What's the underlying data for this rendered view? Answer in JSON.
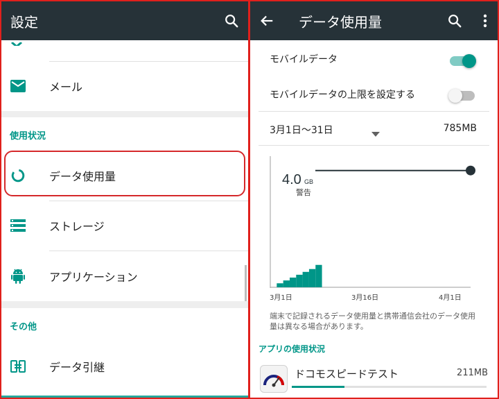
{
  "left": {
    "title": "設定",
    "items_top": [
      {
        "label": "メール",
        "icon": "email-icon"
      }
    ],
    "section_usage": "使用状況",
    "items_usage": [
      {
        "label": "データ使用量",
        "icon": "data-usage-icon"
      },
      {
        "label": "ストレージ",
        "icon": "storage-icon"
      },
      {
        "label": "アプリケーション",
        "icon": "android-icon"
      }
    ],
    "section_other": "その他",
    "items_other": [
      {
        "label": "データ引継",
        "icon": "transfer-icon"
      }
    ]
  },
  "right": {
    "title": "データ使用量",
    "mobile_data_label": "モバイルデータ",
    "mobile_data_on": true,
    "limit_label": "モバイルデータの上限を設定する",
    "limit_on": false,
    "cycle": "3月1日～31日",
    "cycle_total": "785MB",
    "warning_value": "4.0",
    "warning_unit": "GB",
    "warning_label": "警告",
    "note": "端末で記録されるデータ使用量と携帯通信会社のデータ使用量は異なる場合があります。",
    "apps_section": "アプリの使用状況",
    "app": {
      "name": "ドコモスピードテスト",
      "usage": "211MB",
      "usage_fraction": 0.27
    }
  },
  "colors": {
    "appbar": "#263238",
    "accent": "#009688",
    "highlight": "#d5282a"
  },
  "chart_data": {
    "type": "area",
    "x": [
      "3月1日",
      "3月16日",
      "4月1日"
    ],
    "xlim_days": [
      1,
      32
    ],
    "usage_mb": [
      {
        "day": 2,
        "mb": 40
      },
      {
        "day": 3,
        "mb": 140
      },
      {
        "day": 4,
        "mb": 240
      },
      {
        "day": 5,
        "mb": 340
      },
      {
        "day": 6,
        "mb": 440
      },
      {
        "day": 7,
        "mb": 540
      },
      {
        "day": 8,
        "mb": 640
      },
      {
        "day": 9,
        "mb": 785
      }
    ],
    "ylim_mb": [
      0,
      4600
    ],
    "warning_mb": 4096
  }
}
